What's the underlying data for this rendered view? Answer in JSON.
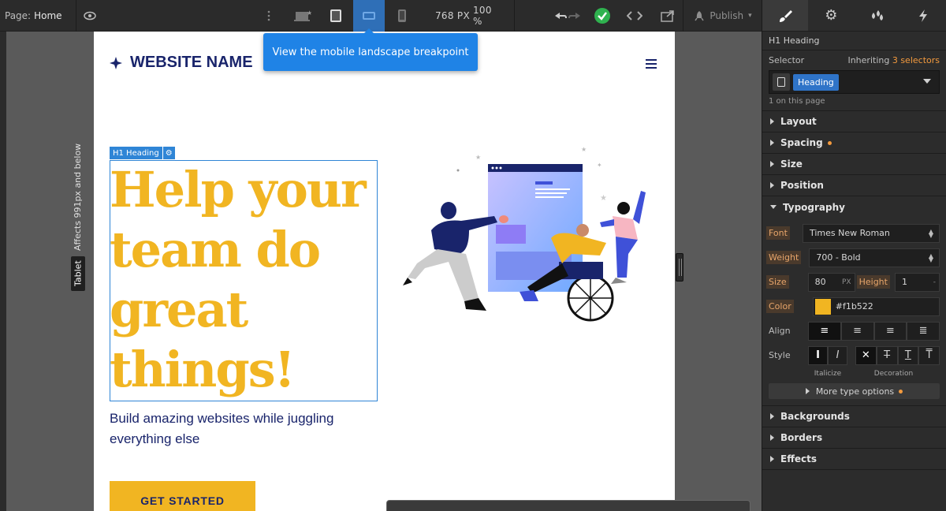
{
  "topbar": {
    "page_prefix": "Page:",
    "page_name": "Home",
    "viewport_width": "768 PX",
    "zoom": "100 %",
    "publish_label": "Publish"
  },
  "tooltip": {
    "text": "View the mobile landscape breakpoint"
  },
  "canvas": {
    "breakpoint_tag": "Tablet",
    "breakpoint_note": "Affects 991px and below"
  },
  "site": {
    "logo_text": "WEBSITE NAME",
    "selected_tag": "H1 Heading",
    "heading": "Help your team do great things!",
    "subheading": "Build amazing websites while juggling everything else",
    "cta": "GET STARTED"
  },
  "panel": {
    "element": "H1  Heading",
    "selector_label": "Selector",
    "inheriting_prefix": "Inheriting",
    "inheriting_count": "3 selectors",
    "selector_chip": "Heading",
    "on_page": "1 on this page",
    "sections_top": [
      "Layout",
      "Spacing",
      "Size",
      "Position"
    ],
    "typography_label": "Typography",
    "typography": {
      "font_label": "Font",
      "font": "Times New Roman",
      "weight_label": "Weight",
      "weight": "700 - Bold",
      "size_label": "Size",
      "size": "80",
      "size_unit": "PX",
      "height_label": "Height",
      "height": "1",
      "height_unit": "-",
      "color_label": "Color",
      "color": "#f1b522",
      "color_text": "#f1b522",
      "align_label": "Align",
      "style_label": "Style",
      "italicize_caption": "Italicize",
      "decoration_caption": "Decoration",
      "more_label": "More type options"
    },
    "sections_bottom": [
      "Backgrounds",
      "Borders",
      "Effects"
    ]
  },
  "colors": {
    "accent": "#f1b522",
    "navy": "#19246b",
    "selection": "#2f85d6"
  }
}
